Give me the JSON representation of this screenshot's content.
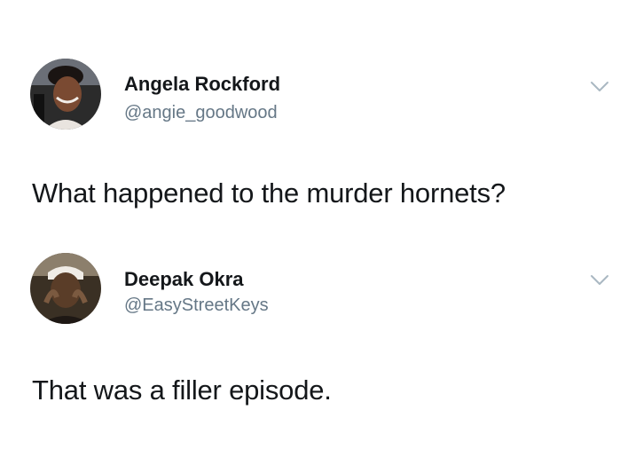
{
  "tweets": [
    {
      "display_name": "Angela Rockford",
      "handle": "@angie_goodwood",
      "text": "What happened to the murder hornets?",
      "avatar_icon": "profile-photo",
      "menu_icon": "chevron-down-icon"
    },
    {
      "display_name": "Deepak Okra",
      "handle": "@EasyStreetKeys",
      "text": "That was a filler episode.",
      "avatar_icon": "profile-photo",
      "menu_icon": "chevron-down-icon"
    }
  ],
  "colors": {
    "name": "#14171a",
    "handle": "#657786",
    "chevron": "#aab8c2",
    "background": "#ffffff"
  }
}
